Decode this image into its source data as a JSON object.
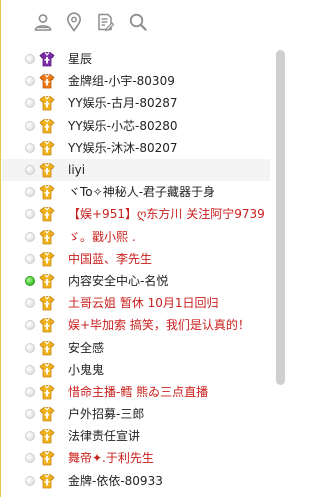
{
  "toolbar": {
    "icons": [
      "contacts-icon",
      "location-pin-icon",
      "edit-list-icon",
      "search-icon"
    ]
  },
  "colors": {
    "frame_accent": "#e6c64c",
    "red_text": "#c8201e",
    "normal_text": "#222222",
    "badge_gold": "#f0b31e",
    "badge_purple": "#7c2ca7",
    "badge_orange": "#ef7a17",
    "online": "#4fcf3a"
  },
  "members": [
    {
      "name": "星辰",
      "badge": "purple",
      "status": "offline",
      "color": "normal"
    },
    {
      "name": "金牌组-小宇-80309",
      "badge": "orange",
      "status": "offline",
      "color": "normal"
    },
    {
      "name": "YY娱乐-古月-80287",
      "badge": "gold",
      "status": "offline",
      "color": "normal"
    },
    {
      "name": "YY娱乐-小芯-80280",
      "badge": "gold",
      "status": "offline",
      "color": "normal"
    },
    {
      "name": "YY娱乐-沐沐-80207",
      "badge": "gold",
      "status": "offline",
      "color": "normal"
    },
    {
      "name": "liyi",
      "badge": "gold",
      "status": "offline",
      "color": "normal",
      "highlight": true
    },
    {
      "name": "ヾTo✧神秘人-君子藏器于身",
      "badge": "gold",
      "status": "offline",
      "color": "normal"
    },
    {
      "name": "【娱+951】ღ东方川 关注阿宁9739",
      "badge": "gold",
      "status": "offline",
      "color": "red"
    },
    {
      "name": "ゞ。戳小熙 .",
      "badge": "gold",
      "status": "offline",
      "color": "red"
    },
    {
      "name": "中国蓝、李先生",
      "badge": "gold",
      "status": "offline",
      "color": "red"
    },
    {
      "name": "内容安全中心-名悦",
      "badge": "gold",
      "status": "online",
      "color": "normal"
    },
    {
      "name": "土哥云姐 暂休 10月1日回归",
      "badge": "gold",
      "status": "offline",
      "color": "red"
    },
    {
      "name": "娱+毕加索  搞笑，我们是认真的！",
      "badge": "gold",
      "status": "offline",
      "color": "red"
    },
    {
      "name": "安全感",
      "badge": "gold",
      "status": "offline",
      "color": "normal"
    },
    {
      "name": "小鬼鬼",
      "badge": "gold",
      "status": "offline",
      "color": "normal"
    },
    {
      "name": "惜命主播-鳕 熊ゐ三点直播",
      "badge": "gold",
      "status": "offline",
      "color": "red"
    },
    {
      "name": "户外招募-三郎",
      "badge": "gold",
      "status": "offline",
      "color": "normal"
    },
    {
      "name": "法律责任宣讲",
      "badge": "gold",
      "status": "offline",
      "color": "normal"
    },
    {
      "name": "舞帝✦.于利先生",
      "badge": "gold",
      "status": "offline",
      "color": "red"
    },
    {
      "name": "金牌-依依-80933",
      "badge": "gold",
      "status": "offline",
      "color": "normal"
    }
  ]
}
